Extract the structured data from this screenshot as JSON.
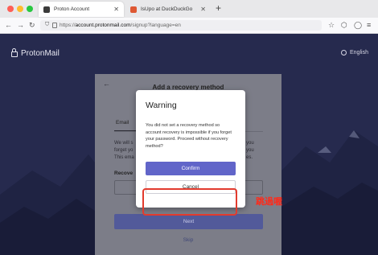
{
  "browser": {
    "tabs": [
      {
        "title": "Proton Account",
        "active": true
      },
      {
        "title": "IsUpo at DuckDuckGo",
        "active": false
      }
    ],
    "new_tab": "+",
    "url_prefix": "https://",
    "url_domain": "account.protonmail.com",
    "url_path": "/signup?language=en",
    "icons": [
      "back-arrow",
      "forward-arrow",
      "reload",
      "shield",
      "pocket",
      "extensions",
      "account",
      "menu"
    ]
  },
  "header": {
    "brand": "ProtonMail",
    "language": "English"
  },
  "card": {
    "title": "Add a recovery method",
    "tab_email": "Email",
    "description": "We will s\nforget yo\nThis ema",
    "description_right": "you\nyou\nes.",
    "recovery_label": "Recove",
    "next_label": "Next",
    "skip_label": "Skip"
  },
  "modal": {
    "title": "Warning",
    "body": "You did not set a recovery method so account recovery is impossible if you forget your password. Proceed without recovery method?",
    "confirm_label": "Confirm",
    "cancel_label": "Cancel"
  },
  "annotation": {
    "text": "跳過喔",
    "color": "#ff2a1a"
  },
  "colors": {
    "accent": "#6165c9",
    "page_bg": "#262a4e",
    "highlight": "#e23b2e"
  }
}
